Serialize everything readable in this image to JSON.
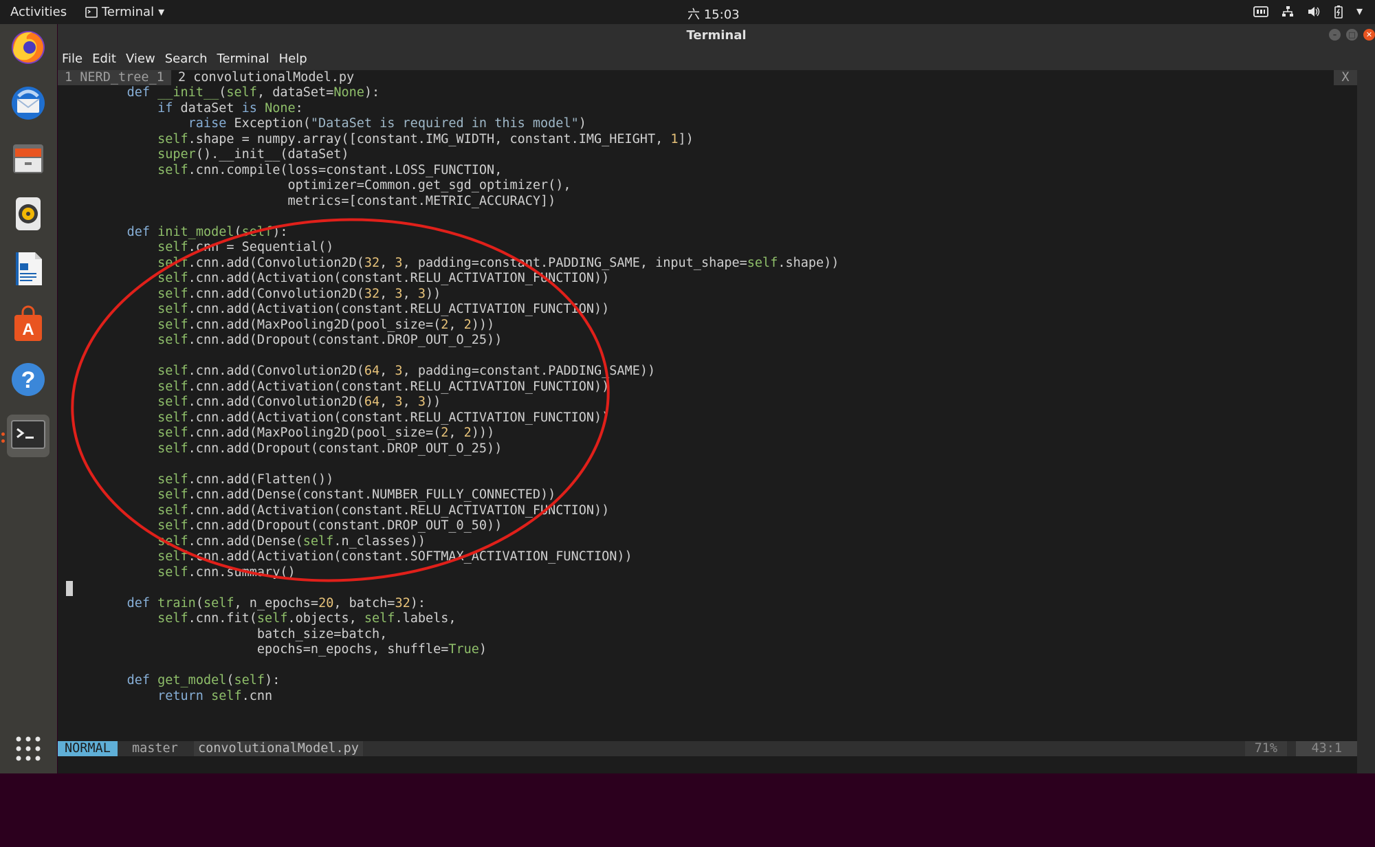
{
  "topbar": {
    "activities": "Activities",
    "app_name": "Terminal",
    "clock": "六 15:03"
  },
  "window": {
    "title": "Terminal",
    "menu": [
      "File",
      "Edit",
      "View",
      "Search",
      "Terminal",
      "Help"
    ]
  },
  "vim": {
    "tabs": [
      {
        "label": "1 NERD_tree_1 -"
      },
      {
        "label": "2 convolutionalModel.py"
      }
    ],
    "tab_close": "X",
    "status": {
      "mode": "NORMAL",
      "branch": "master",
      "file": "convolutionalModel.py",
      "percent": "71%",
      "position": "43:1"
    }
  },
  "dock": {
    "items": [
      "firefox-icon",
      "thunderbird-icon",
      "files-icon",
      "rhythmbox-icon",
      "writer-icon",
      "software-center-icon",
      "help-icon",
      "terminal-icon"
    ],
    "apps_grid": "show-applications-icon"
  },
  "colors": {
    "annotation_circle": "#e0201a",
    "accent": "#e95420",
    "mode_bg": "#5fafd7"
  }
}
